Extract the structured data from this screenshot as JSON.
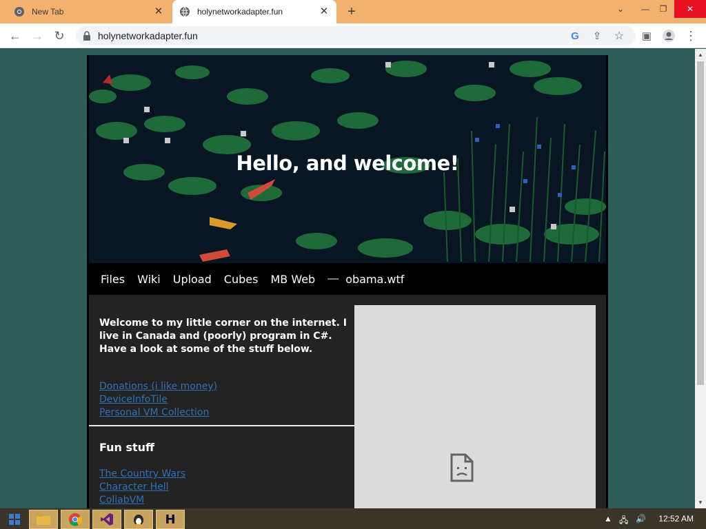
{
  "browser": {
    "tabs": [
      {
        "title": "New Tab",
        "active": false
      },
      {
        "title": "holynetworkadapter.fun",
        "active": true
      }
    ],
    "url": "holynetworkadapter.fun"
  },
  "page": {
    "hero_title": "Hello, and welcome!",
    "nav": [
      "Files",
      "Wiki",
      "Upload",
      "Cubes",
      "MB Web"
    ],
    "nav_sep": "—",
    "nav_extra": "obama.wtf",
    "intro": "Welcome to my little corner on the internet. I live in Canada and (poorly) program in C#. Have a look at some of the stuff below.",
    "links": [
      "Donations (i like money)",
      "DeviceInfoTile",
      "Personal VM Collection"
    ],
    "fun_heading": "Fun stuff",
    "fun_links": [
      "The Country Wars",
      "Character Hell",
      "CollabVM"
    ]
  },
  "taskbar": {
    "clock": "12:52 AM",
    "apps": [
      "windows-start-icon",
      "file-explorer-icon",
      "chrome-icon",
      "visual-studio-icon",
      "qemu-icon",
      "h-app-icon"
    ]
  },
  "colors": {
    "page_bg": "#2e5b55",
    "tabbar": "#f1b16f",
    "link": "#2e6fb5",
    "content_bg": "#232323"
  }
}
